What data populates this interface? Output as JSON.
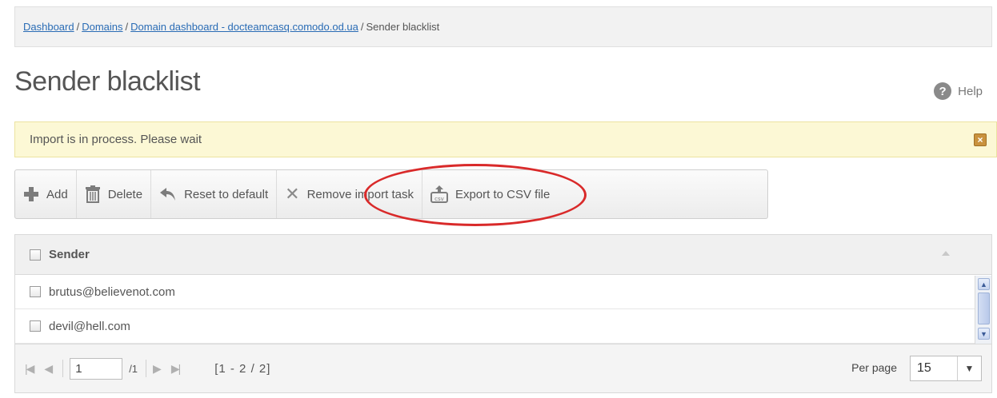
{
  "breadcrumb": {
    "items": [
      "Dashboard",
      "Domains",
      "Domain dashboard - docteamcasq.comodo.od.ua"
    ],
    "separator": "/",
    "current": "Sender blacklist"
  },
  "page": {
    "title": "Sender blacklist",
    "help_label": "Help",
    "help_icon_glyph": "?"
  },
  "alert": {
    "message": "Import is in process. Please wait",
    "close_glyph": "×"
  },
  "toolbar": {
    "add_label": "Add",
    "delete_label": "Delete",
    "reset_label": "Reset to default",
    "remove_import_label": "Remove import task",
    "export_label": "Export to CSV file"
  },
  "grid": {
    "column_header": "Sender",
    "rows": [
      "brutus@believenot.com",
      "devil@hell.com"
    ]
  },
  "pager": {
    "current_page": "1",
    "total_pages": "/1",
    "range": "[1 - 2 / 2]",
    "per_page_label": "Per page",
    "per_page_value": "15"
  },
  "colors": {
    "link": "#2a6cb5",
    "alert_bg": "#fcf8d5",
    "highlight_ring": "#d92a2a"
  }
}
